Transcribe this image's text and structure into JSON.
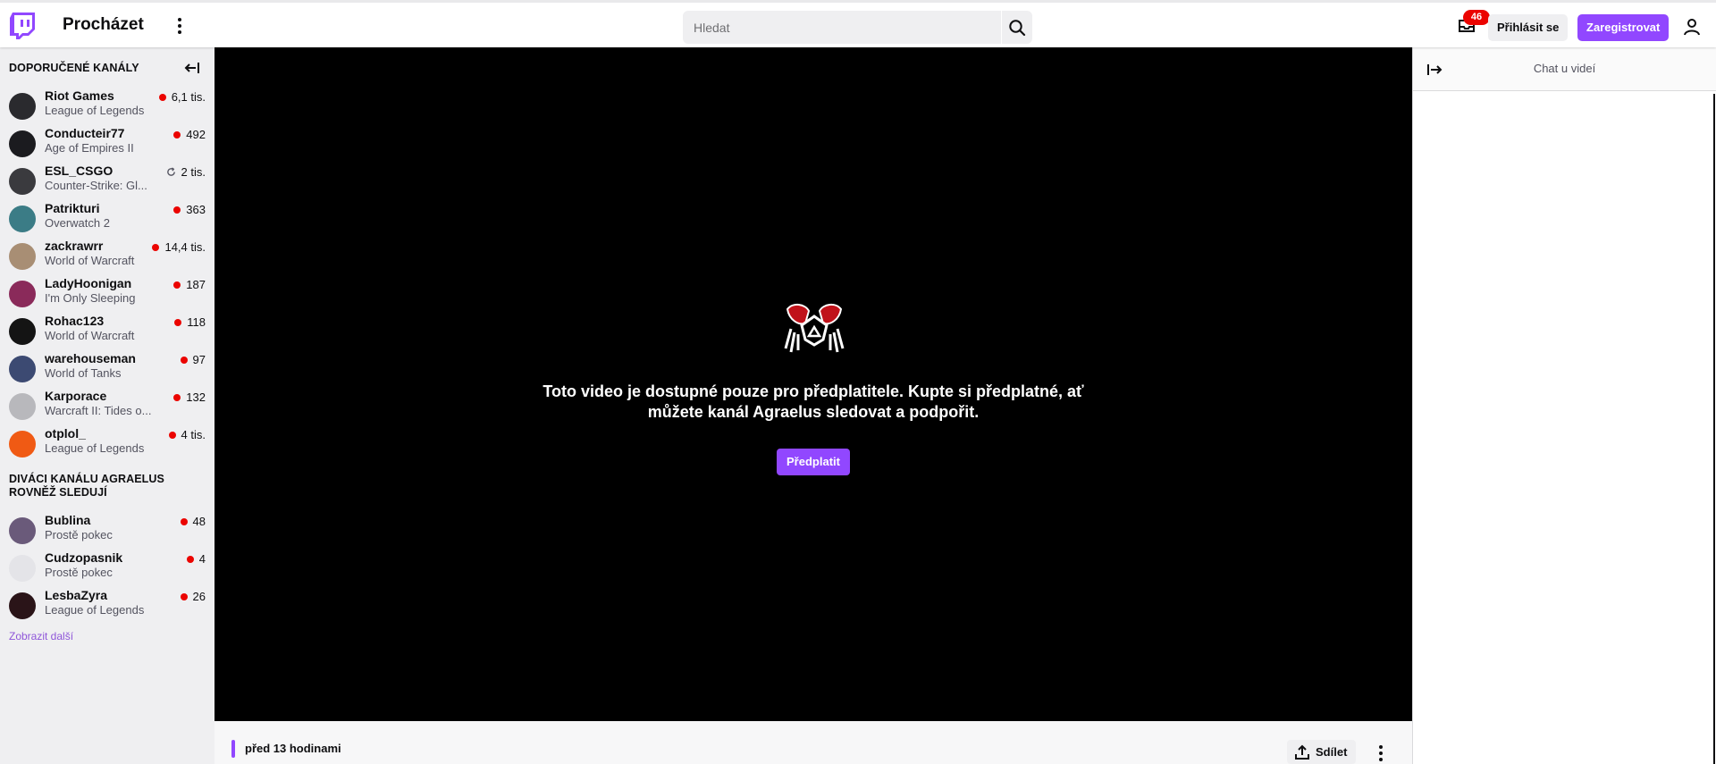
{
  "header": {
    "browse_label": "Procházet",
    "search_placeholder": "Hledat",
    "inbox_count": "46",
    "login_label": "Přihlásit se",
    "signup_label": "Zaregistrovat"
  },
  "sidebar": {
    "recommended_title": "DOPORUČENÉ KANÁLY",
    "recommended": [
      {
        "name": "Riot Games",
        "game": "League of Legends",
        "viewers": "6,1 tis.",
        "status": "live",
        "avatar_color": "#2a2a2e"
      },
      {
        "name": "Conducteir77",
        "game": "Age of Empires II",
        "viewers": "492",
        "status": "live",
        "avatar_color": "#1b1b1f"
      },
      {
        "name": "ESL_CSGO",
        "game": "Counter-Strike: Gl...",
        "viewers": "2 tis.",
        "status": "rerun",
        "avatar_color": "#3a3a3e"
      },
      {
        "name": "Patrikturi",
        "game": "Overwatch 2",
        "viewers": "363",
        "status": "live",
        "avatar_color": "#3b7c86"
      },
      {
        "name": "zackrawrr",
        "game": "World of Warcraft",
        "viewers": "14,4 tis.",
        "status": "live",
        "avatar_color": "#a88e74"
      },
      {
        "name": "LadyHoonigan",
        "game": "I'm Only Sleeping",
        "viewers": "187",
        "status": "live",
        "avatar_color": "#8a2a5a"
      },
      {
        "name": "Rohac123",
        "game": "World of Warcraft",
        "viewers": "118",
        "status": "live",
        "avatar_color": "#141414"
      },
      {
        "name": "warehouseman",
        "game": "World of Tanks",
        "viewers": "97",
        "status": "live",
        "avatar_color": "#3c4a72"
      },
      {
        "name": "Karporace",
        "game": "Warcraft II: Tides o...",
        "viewers": "132",
        "status": "live",
        "avatar_color": "#b8b8bc"
      },
      {
        "name": "otplol_",
        "game": "League of Legends",
        "viewers": "4 tis.",
        "status": "live",
        "avatar_color": "#f05a14"
      }
    ],
    "also_watch_title": "DIVÁCI KANÁLU AGRAELUS ROVNĚŽ SLEDUJÍ",
    "also_watch": [
      {
        "name": "Bublina",
        "game": "Prostě pokec",
        "viewers": "48",
        "status": "live",
        "avatar_color": "#6a5a7a"
      },
      {
        "name": "Cudzopasnik",
        "game": "Prostě pokec",
        "viewers": "4",
        "status": "live",
        "avatar_color": "#e4e4e8"
      },
      {
        "name": "LesbaZyra",
        "game": "League of Legends",
        "viewers": "26",
        "status": "live",
        "avatar_color": "#2a1418"
      }
    ],
    "show_more": "Zobrazit další"
  },
  "player": {
    "message": "Toto video je dostupné pouze pro předplatitele. Kupte si předplatné, ať můžete kanál Agraelus sledovat a podpořit.",
    "subscribe_label": "Předplatit"
  },
  "info": {
    "time": "před 13 hodinami",
    "share_label": "Sdílet"
  },
  "chat": {
    "title": "Chat u videí"
  },
  "colors": {
    "brand": "#9147ff",
    "live": "#eb0400"
  }
}
